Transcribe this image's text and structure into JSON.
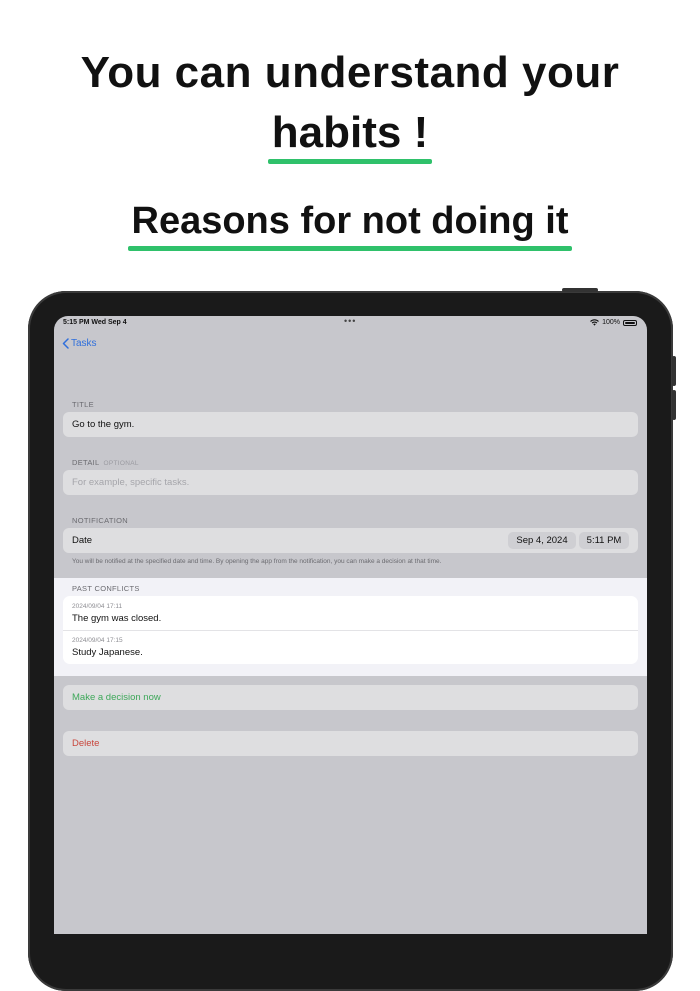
{
  "promo": {
    "headline_line1": "You can understand your",
    "headline_line2": "habits !",
    "subheadline": "Reasons for not doing it",
    "accent_color": "#2fc16b"
  },
  "status_bar": {
    "time": "5:15 PM   Wed Sep 4",
    "battery": "100%"
  },
  "nav": {
    "back_label": "Tasks"
  },
  "form": {
    "title_label": "TITLE",
    "title_value": "Go to the gym.",
    "detail_label": "DETAIL",
    "detail_optional": "OPTIONAL",
    "detail_placeholder": "For example, specific tasks.",
    "notification_label": "NOTIFICATION",
    "date_label": "Date",
    "date_value": "Sep 4, 2024",
    "time_value": "5:11 PM",
    "notification_note": "You will be notified at the specified date and time. By opening the app from the notification, you can make a decision at that time."
  },
  "conflicts": {
    "label": "PAST CONFLICTS",
    "items": [
      {
        "timestamp": "2024/09/04 17:11",
        "text": "The gym was closed."
      },
      {
        "timestamp": "2024/09/04 17:15",
        "text": "Study Japanese."
      }
    ]
  },
  "actions": {
    "decide_label": "Make a decision now",
    "delete_label": "Delete"
  }
}
